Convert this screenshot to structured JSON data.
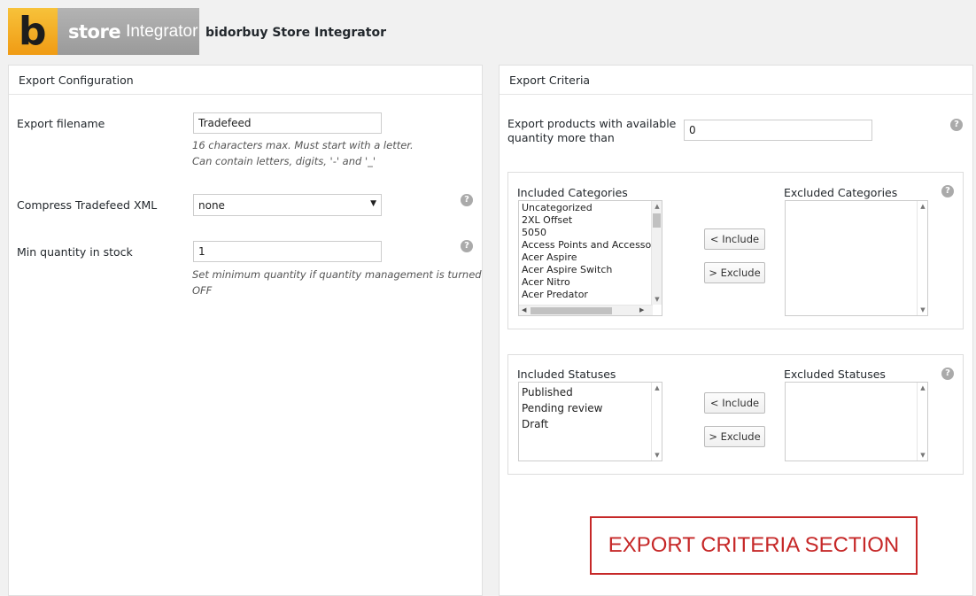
{
  "header": {
    "logo_letter": "b",
    "logo_store": "store",
    "logo_integrator": "Integrator",
    "title": "bidorbuy Store Integrator"
  },
  "config": {
    "title": "Export Configuration",
    "filename_label": "Export filename",
    "filename_value": "Tradefeed",
    "filename_hint1": "16 characters max. Must start with a letter.",
    "filename_hint2": "Can contain letters, digits, '-' and '_'",
    "compress_label": "Compress Tradefeed XML",
    "compress_value": "none",
    "minqty_label": "Min quantity in stock",
    "minqty_value": "1",
    "minqty_hint1": "Set minimum quantity if quantity management is turned",
    "minqty_hint2": "OFF",
    "help_glyph": "?"
  },
  "criteria": {
    "title": "Export Criteria",
    "qty_label1": "Export products with available",
    "qty_label2": "quantity more than",
    "qty_value": "0",
    "included_categories_label": "Included Categories",
    "excluded_categories_label": "Excluded Categories",
    "included_categories": [
      "Uncategorized",
      "2XL Offset",
      "5050",
      "Access Points and Accessori",
      "Acer Aspire",
      "Acer Aspire Switch",
      "Acer Nitro",
      "Acer Predator"
    ],
    "included_statuses_label": "Included Statuses",
    "excluded_statuses_label": "Excluded Statuses",
    "included_statuses": [
      "Published",
      "Pending review",
      "Draft"
    ],
    "include_btn": "< Include",
    "exclude_btn": "> Exclude"
  },
  "annotation": "EXPORT CRITERIA SECTION",
  "colors": {
    "annotation": "#c62828",
    "logo_orange": "#f5b02a",
    "logo_gray": "#a6a6a6"
  }
}
